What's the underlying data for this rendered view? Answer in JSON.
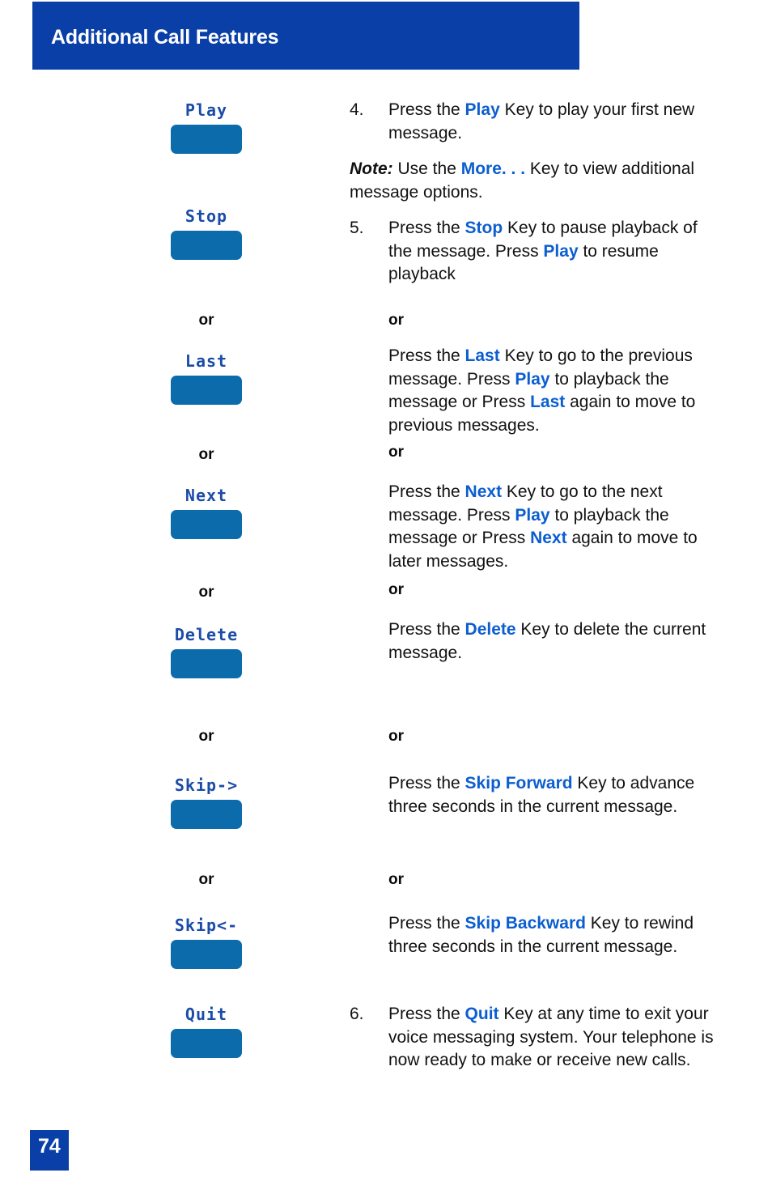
{
  "header": {
    "title": "Additional Call Features",
    "band_color": "#0A3FA8"
  },
  "colors": {
    "header_blue": "#0A3FA8",
    "keyword_blue": "#0B5ED0",
    "key_label_blue": "#1B4CA8",
    "key_button_blue": "#0B6BAB",
    "body_text": "#111111"
  },
  "keys": {
    "play": "Play",
    "stop": "Stop",
    "last": "Last",
    "next": "Next",
    "delete": "Delete",
    "skip_forward": "Skip->",
    "skip_backward": "Skip<-",
    "quit": "Quit"
  },
  "or_label": "or",
  "steps": {
    "step4": {
      "number": "4.",
      "text_parts": [
        {
          "t": "Press the ",
          "b": false
        },
        {
          "t": "Play",
          "b": true
        },
        {
          "t": " Key to play your first new message.",
          "b": false
        }
      ],
      "plain": "Press the Play Key to play your first new message."
    },
    "note": {
      "label": "Note:",
      "text_parts": [
        {
          "t": "  Use the ",
          "b": false
        },
        {
          "t": "More. . .",
          "b": true
        },
        {
          "t": " Key to view additional message options.",
          "b": false
        }
      ],
      "plain": "Note:  Use the More. . . Key to view additional message options."
    },
    "step5": {
      "number": "5.",
      "text_parts": [
        {
          "t": "Press the ",
          "b": false
        },
        {
          "t": "Stop",
          "b": true
        },
        {
          "t": " Key to pause playback of the message. Press ",
          "b": false
        },
        {
          "t": "Play",
          "b": true
        },
        {
          "t": " to resume playback",
          "b": false
        }
      ],
      "plain": "Press the Stop Key to pause playback of the message. Press Play to resume playback"
    },
    "last_para": {
      "text_parts": [
        {
          "t": "Press the ",
          "b": false
        },
        {
          "t": "Last",
          "b": true
        },
        {
          "t": " Key to go to the previous message. Press ",
          "b": false
        },
        {
          "t": "Play",
          "b": true
        },
        {
          "t": " to playback the message or Press ",
          "b": false
        },
        {
          "t": "Last",
          "b": true
        },
        {
          "t": " again to move to previous messages.",
          "b": false
        }
      ],
      "plain": "Press the Last Key to go to the previous message. Press Play to playback the message or Press Last again to move to previous messages."
    },
    "next_para": {
      "text_parts": [
        {
          "t": "Press the ",
          "b": false
        },
        {
          "t": "Next",
          "b": true
        },
        {
          "t": " Key to go to the next message. Press ",
          "b": false
        },
        {
          "t": "Play",
          "b": true
        },
        {
          "t": " to playback the message or Press ",
          "b": false
        },
        {
          "t": "Next",
          "b": true
        },
        {
          "t": " again to move to later messages.",
          "b": false
        }
      ],
      "plain": "Press the Next Key to go to the next message. Press Play to playback the message or Press Next again to move to later messages."
    },
    "delete_para": {
      "text_parts": [
        {
          "t": "Press the ",
          "b": false
        },
        {
          "t": "Delete",
          "b": true
        },
        {
          "t": " Key to delete the current message.",
          "b": false
        }
      ],
      "plain": "Press the Delete Key to delete the current message."
    },
    "skip_forward_para": {
      "text_parts": [
        {
          "t": "Press the ",
          "b": false
        },
        {
          "t": "Skip Forward",
          "b": true
        },
        {
          "t": " Key to advance three seconds in the current message.",
          "b": false
        }
      ],
      "plain": "Press the Skip Forward Key to advance three seconds in the current message."
    },
    "skip_backward_para": {
      "text_parts": [
        {
          "t": "Press the ",
          "b": false
        },
        {
          "t": "Skip Backward",
          "b": true
        },
        {
          "t": " Key to rewind three seconds in the current message.",
          "b": false
        }
      ],
      "plain": "Press the Skip Backward Key to rewind three seconds in the current message."
    },
    "step6": {
      "number": "6.",
      "text_parts": [
        {
          "t": "Press the ",
          "b": false
        },
        {
          "t": "Quit",
          "b": true
        },
        {
          "t": " Key at any time to exit your voice messaging system. Your telephone is now ready to make or receive new calls.",
          "b": false
        }
      ],
      "plain": "Press the Quit Key at any time to exit your voice messaging system. Your telephone is now ready to make or receive new calls."
    }
  },
  "footer": {
    "page_number": "74"
  }
}
